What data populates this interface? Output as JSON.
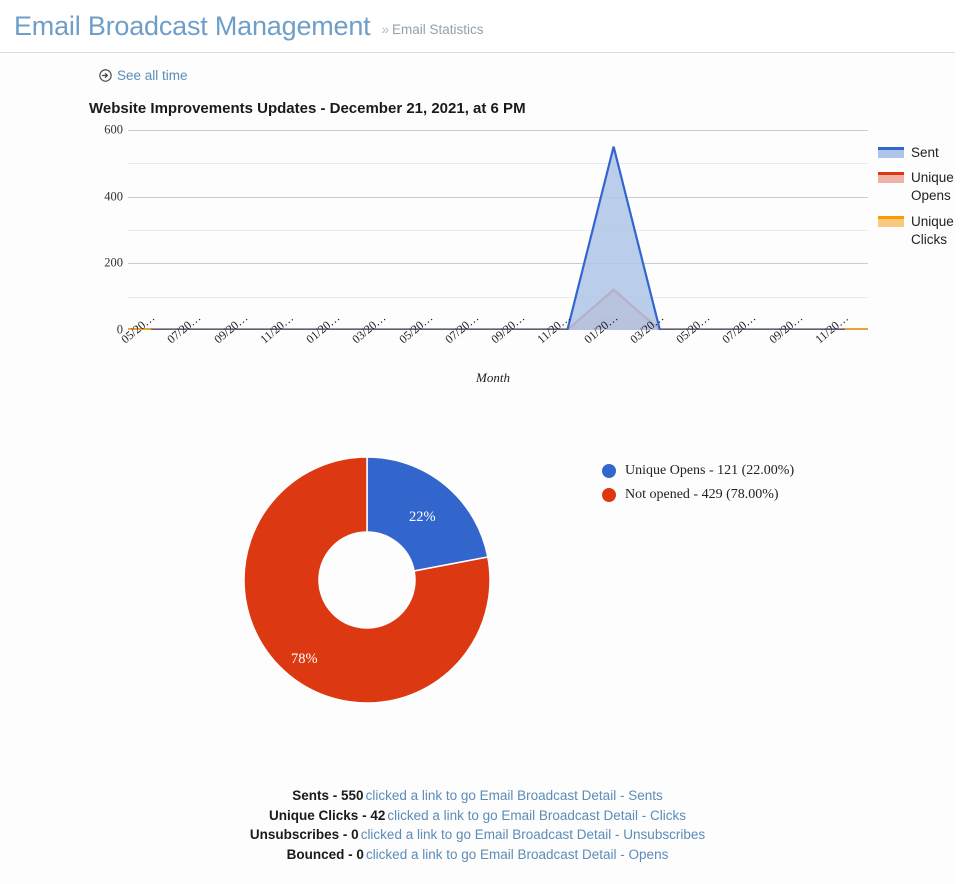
{
  "header": {
    "title": "Email Broadcast Management",
    "breadcrumb_separator": "»",
    "breadcrumb": "Email Statistics",
    "title_color": "#6f9fc8",
    "breadcrumb_color": "#95a0ab"
  },
  "toolbar": {
    "see_all_time_label": "See all time",
    "see_all_time_icon": "arrow-circle-right-icon",
    "link_color": "#5c8cb8"
  },
  "chart_data": [
    {
      "type": "area",
      "title": "Website Improvements Updates - December 21, 2021, at 6 PM",
      "xlabel": "Month",
      "ylabel": "",
      "ylim": [
        0,
        600
      ],
      "yticks": [
        0,
        200,
        400,
        600
      ],
      "gridlines": [
        0,
        100,
        200,
        300,
        400,
        500,
        600
      ],
      "grid": true,
      "legend_position": "right",
      "x": [
        "05/20…",
        "07/20…",
        "09/20…",
        "11/20…",
        "01/20…",
        "03/20…",
        "05/20…",
        "07/20…",
        "09/20…",
        "11/20…",
        "01/20…",
        "03/20…",
        "05/20…",
        "07/20…",
        "09/20…",
        "11/20…"
      ],
      "series": [
        {
          "name": "Sent",
          "color": "#3366cc",
          "fill": "#aec4e8",
          "values": [
            0,
            0,
            0,
            0,
            0,
            0,
            0,
            0,
            0,
            0,
            550,
            0,
            0,
            0,
            0,
            0
          ]
        },
        {
          "name": "Unique Opens",
          "color": "#dc3912",
          "fill": "#efb2a4",
          "values": [
            0,
            0,
            0,
            0,
            0,
            0,
            0,
            0,
            0,
            0,
            121,
            0,
            0,
            0,
            0,
            0
          ]
        },
        {
          "name": "Unique Clicks",
          "color": "#ff9900",
          "fill": "#f7ca80",
          "values": [
            0,
            0,
            0,
            0,
            0,
            0,
            0,
            0,
            0,
            0,
            42,
            0,
            0,
            0,
            0,
            0
          ]
        }
      ],
      "peak_index": 10
    },
    {
      "type": "pie",
      "variant": "donut",
      "title": "",
      "labels": [
        "Unique Opens",
        "Not opened"
      ],
      "values": [
        121,
        429
      ],
      "percents": [
        22.0,
        78.0
      ],
      "slice_labels": [
        "22%",
        "78%"
      ],
      "colors": [
        "#3366cc",
        "#dc3912"
      ],
      "legend_position": "right",
      "legend_entries": [
        "Unique Opens - 121 (22.00%)",
        "Not opened - 429 (78.00%)"
      ]
    }
  ],
  "footer_stats": [
    {
      "key": "Sents - 550",
      "link": "clicked a link to go Email Broadcast Detail - Sents"
    },
    {
      "key": "Unique Clicks - 42",
      "link": "clicked a link to go Email Broadcast Detail - Clicks"
    },
    {
      "key": "Unsubscribes - 0",
      "link": "clicked a link to go Email Broadcast Detail - Unsubscribes"
    },
    {
      "key": "Bounced - 0",
      "link": "clicked a link to go Email Broadcast Detail - Opens"
    }
  ]
}
